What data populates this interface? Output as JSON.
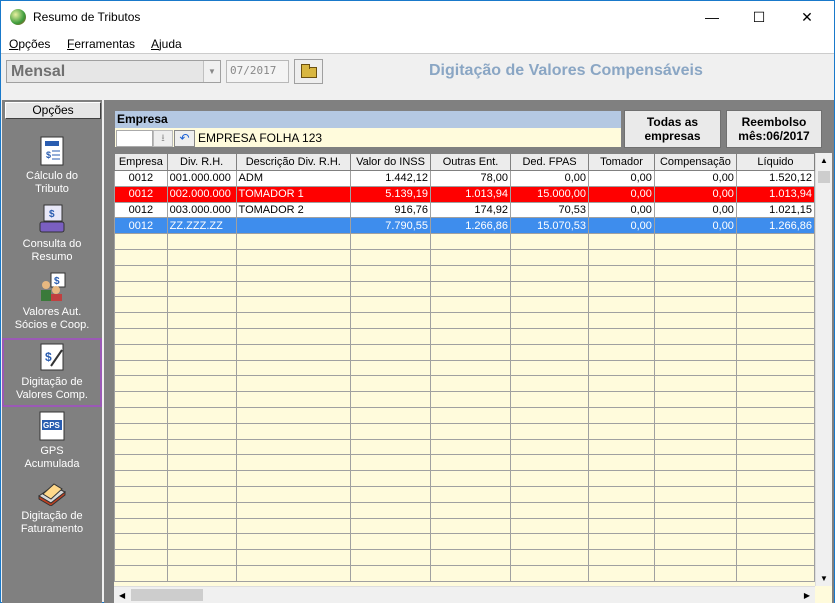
{
  "window": {
    "title": "Resumo de Tributos",
    "minimize": "—",
    "maximize": "☐",
    "close": "✕"
  },
  "menu": [
    {
      "first": "O",
      "rest": "pções"
    },
    {
      "first": "F",
      "rest": "erramentas"
    },
    {
      "first": "A",
      "rest": "juda"
    }
  ],
  "toolbar": {
    "mode": "Mensal",
    "period": "07/2017",
    "header_title": "Digitação de Valores Compensáveis"
  },
  "sidebar": {
    "header": "Opções",
    "items": [
      {
        "label1": "Cálculo do",
        "label2": "Tributo",
        "icon": "calc-icon"
      },
      {
        "label1": "Consulta do",
        "label2": "Resumo",
        "icon": "consulta-icon"
      },
      {
        "label1": "Valores Aut.",
        "label2": "Sócios e  Coop.",
        "icon": "socios-icon"
      },
      {
        "label1": "Digitação de",
        "label2": "Valores Comp.",
        "icon": "digitacao-icon"
      },
      {
        "label1": "GPS",
        "label2": "Acumulada",
        "icon": "gps-icon"
      },
      {
        "label1": "Digitação de",
        "label2": "Faturamento",
        "icon": "faturamento-icon"
      }
    ]
  },
  "empresa": {
    "label": "Empresa",
    "name": "EMPRESA FOLHA 123"
  },
  "buttons": {
    "todas_line1": "Todas as",
    "todas_line2": "empresas",
    "reembolso_line1": "Reembolso",
    "reembolso_line2": "mês:06/2017"
  },
  "table": {
    "columns": [
      "Empresa",
      "Div. R.H.",
      "Descrição Div. R.H.",
      "Valor do INSS",
      "Outras Ent.",
      "Ded. FPAS",
      "Tomador",
      "Compensação",
      "Líquido"
    ],
    "rows": [
      [
        "0012",
        "001.000.000",
        "ADM",
        "1.442,12",
        "78,00",
        "0,00",
        "0,00",
        "0,00",
        "1.520,12"
      ],
      [
        "0012",
        "002.000.000",
        "TOMADOR 1",
        "5.139,19",
        "1.013,94",
        "15.000,00",
        "0,00",
        "0,00",
        "1.013,94"
      ],
      [
        "0012",
        "003.000.000",
        "TOMADOR 2",
        "916,76",
        "174,92",
        "70,53",
        "0,00",
        "0,00",
        "1.021,15"
      ],
      [
        "0012",
        "ZZ.ZZZ.ZZ",
        "",
        "7.790,55",
        "1.266,86",
        "15.070,53",
        "0,00",
        "0,00",
        "1.266,86"
      ]
    ]
  },
  "colors": {
    "selected_row": "#ff0000",
    "total_row": "#3e8ded",
    "grid_bg": "#fffbdc",
    "header_accent": "#8aa6c4"
  }
}
